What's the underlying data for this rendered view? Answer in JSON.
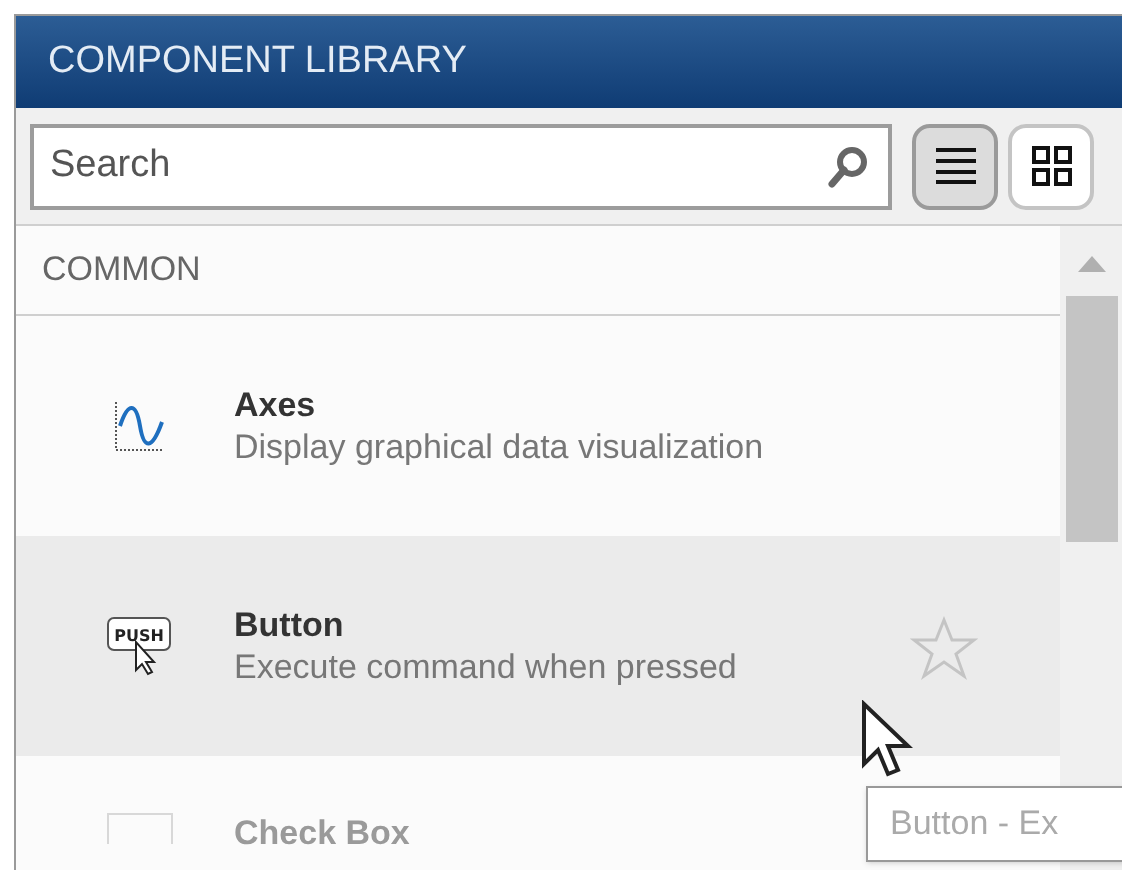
{
  "panel": {
    "title": "COMPONENT LIBRARY"
  },
  "search": {
    "placeholder": "Search"
  },
  "view_toggles": [
    {
      "kind": "list",
      "selected": true
    },
    {
      "kind": "grid",
      "selected": false
    }
  ],
  "section": {
    "title": "COMMON"
  },
  "items": [
    {
      "kind": "axes",
      "name": "Axes",
      "description": "Display graphical data visualization",
      "hovered": false,
      "faded": false
    },
    {
      "kind": "button",
      "icon_text": "PUSH",
      "name": "Button",
      "description": "Execute command when pressed",
      "hovered": true,
      "faded": false
    },
    {
      "kind": "checkbox",
      "name": "Check Box",
      "hovered": false,
      "faded": true
    }
  ],
  "tooltip": {
    "text": "Button - Ex"
  }
}
